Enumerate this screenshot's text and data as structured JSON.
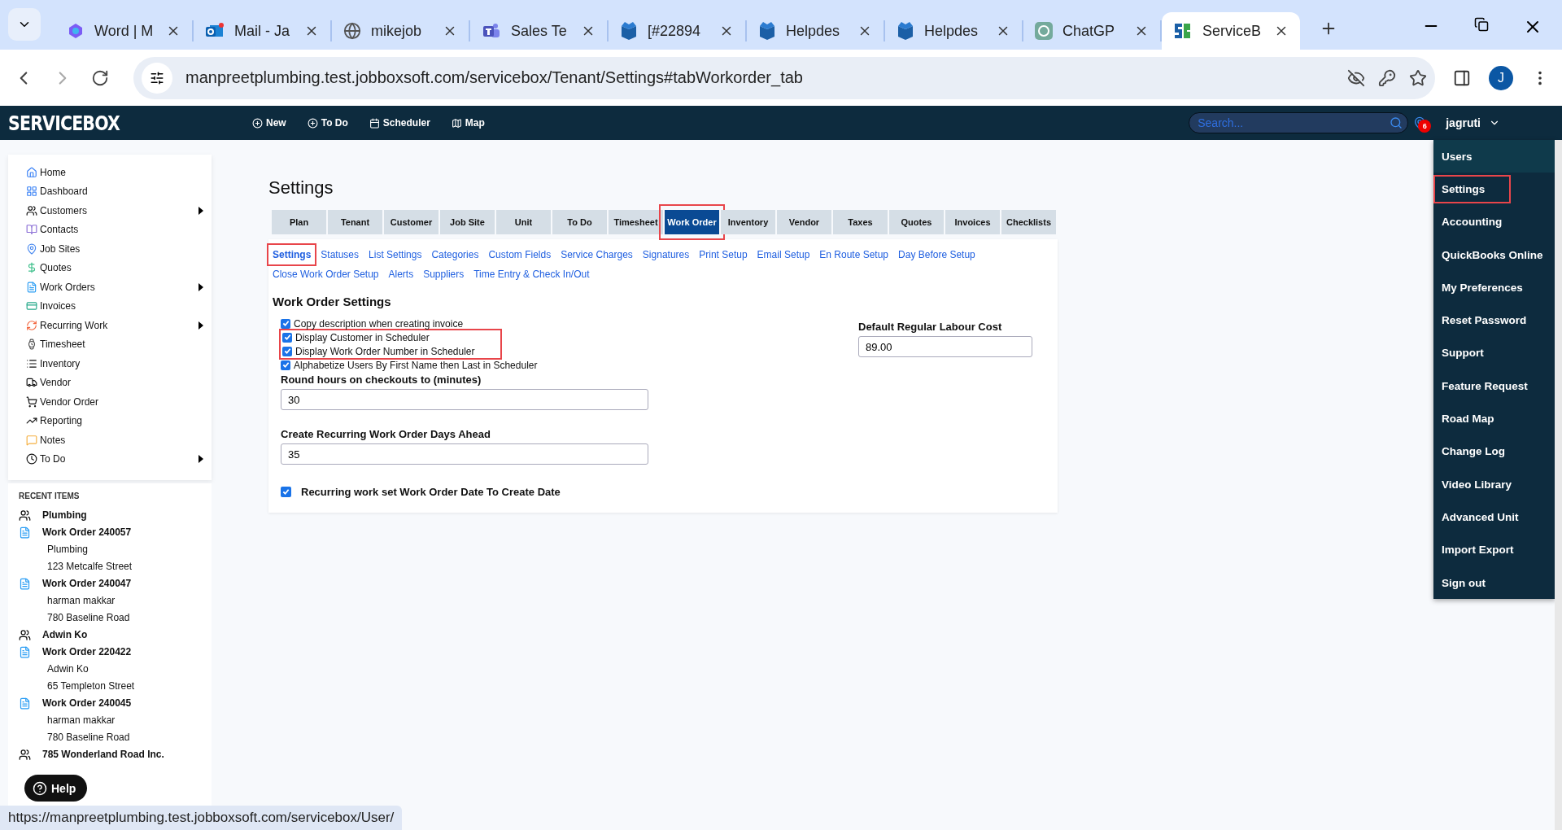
{
  "browser": {
    "tabs": [
      {
        "title": "Word | M",
        "selected": false
      },
      {
        "title": "Mail - Ja",
        "selected": false
      },
      {
        "title": "mikejob",
        "selected": false
      },
      {
        "title": "Sales Te",
        "selected": false
      },
      {
        "title": "[#22894",
        "selected": false
      },
      {
        "title": "Helpdes",
        "selected": false
      },
      {
        "title": "Helpdes",
        "selected": false
      },
      {
        "title": "ChatGP",
        "selected": false
      },
      {
        "title": "ServiceB",
        "selected": true
      }
    ],
    "address": "manpreetplumbing.test.jobboxsoft.com/servicebox/Tenant/Settings#tabWorkorder_tab",
    "profile_initial": "J"
  },
  "app": {
    "logo": "SERVICEBOX",
    "nav": [
      "New",
      "To Do",
      "Scheduler",
      "Map"
    ],
    "search": {
      "placeholder": "Search..."
    },
    "notification_count": "6",
    "user": "jagruti"
  },
  "sidebar": {
    "items": [
      {
        "label": "Home",
        "has_submenu": false
      },
      {
        "label": "Dashboard",
        "has_submenu": false
      },
      {
        "label": "Customers",
        "has_submenu": true
      },
      {
        "label": "Contacts",
        "has_submenu": false
      },
      {
        "label": "Job Sites",
        "has_submenu": false
      },
      {
        "label": "Quotes",
        "has_submenu": false
      },
      {
        "label": "Work Orders",
        "has_submenu": true
      },
      {
        "label": "Invoices",
        "has_submenu": false
      },
      {
        "label": "Recurring Work",
        "has_submenu": true
      },
      {
        "label": "Timesheet",
        "has_submenu": false
      },
      {
        "label": "Inventory",
        "has_submenu": false
      },
      {
        "label": "Vendor",
        "has_submenu": false
      },
      {
        "label": "Vendor Order",
        "has_submenu": false
      },
      {
        "label": "Reporting",
        "has_submenu": false
      },
      {
        "label": "Notes",
        "has_submenu": false
      },
      {
        "label": "To Do",
        "has_submenu": true
      }
    ]
  },
  "recent_items": {
    "title": "RECENT ITEMS",
    "items": [
      {
        "kind": "customer",
        "title": "Plumbing"
      },
      {
        "kind": "work_order",
        "title": "Work Order 240057",
        "lines": [
          "Plumbing",
          "123 Metcalfe Street"
        ]
      },
      {
        "kind": "work_order",
        "title": "Work Order 240047",
        "lines": [
          "harman makkar",
          "780 Baseline Road"
        ]
      },
      {
        "kind": "customer",
        "title": "Adwin Ko"
      },
      {
        "kind": "work_order",
        "title": "Work Order 220422",
        "lines": [
          "Adwin Ko",
          "65 Templeton Street"
        ]
      },
      {
        "kind": "work_order",
        "title": "Work Order 240045",
        "lines": [
          "harman makkar",
          "780 Baseline Road"
        ]
      },
      {
        "kind": "customer",
        "title": "785 Wonderland Road Inc."
      }
    ]
  },
  "page": {
    "title": "Settings",
    "tabs": [
      {
        "label": "Plan",
        "selected": false,
        "highlighted": false
      },
      {
        "label": "Tenant",
        "selected": false,
        "highlighted": false
      },
      {
        "label": "Customer",
        "selected": false,
        "highlighted": false
      },
      {
        "label": "Job Site",
        "selected": false,
        "highlighted": false
      },
      {
        "label": "Unit",
        "selected": false,
        "highlighted": false
      },
      {
        "label": "To Do",
        "selected": false,
        "highlighted": false
      },
      {
        "label": "Timesheet",
        "selected": false,
        "highlighted": false
      },
      {
        "label": "Work Order",
        "selected": true,
        "highlighted": true
      },
      {
        "label": "Inventory",
        "selected": false,
        "highlighted": false
      },
      {
        "label": "Vendor",
        "selected": false,
        "highlighted": false
      },
      {
        "label": "Taxes",
        "selected": false,
        "highlighted": false
      },
      {
        "label": "Quotes",
        "selected": false,
        "highlighted": false
      },
      {
        "label": "Invoices",
        "selected": false,
        "highlighted": false
      },
      {
        "label": "Checklists",
        "selected": false,
        "highlighted": false
      }
    ],
    "subtabs": [
      {
        "label": "Settings",
        "selected": true,
        "highlighted": true
      },
      {
        "label": "Statuses",
        "selected": false,
        "highlighted": false
      },
      {
        "label": "List Settings",
        "selected": false,
        "highlighted": false
      },
      {
        "label": "Categories",
        "selected": false,
        "highlighted": false
      },
      {
        "label": "Custom Fields",
        "selected": false,
        "highlighted": false
      },
      {
        "label": "Service Charges",
        "selected": false,
        "highlighted": false
      },
      {
        "label": "Signatures",
        "selected": false,
        "highlighted": false
      },
      {
        "label": "Print Setup",
        "selected": false,
        "highlighted": false
      },
      {
        "label": "Email Setup",
        "selected": false,
        "highlighted": false
      },
      {
        "label": "En Route Setup",
        "selected": false,
        "highlighted": false
      },
      {
        "label": "Day Before Setup",
        "selected": false,
        "highlighted": false
      },
      {
        "label": "Close Work Order Setup",
        "selected": false,
        "highlighted": false
      },
      {
        "label": "Alerts",
        "selected": false,
        "highlighted": false
      },
      {
        "label": "Suppliers",
        "selected": false,
        "highlighted": false
      },
      {
        "label": "Time Entry & Check In/Out",
        "selected": false,
        "highlighted": false
      }
    ],
    "section_title": "Work Order Settings",
    "options": [
      {
        "label": "Copy description when creating invoice",
        "checked": true,
        "highlighted": false
      },
      {
        "label": "Display Customer in Scheduler",
        "checked": true,
        "highlighted": true
      },
      {
        "label": "Display Work Order Number in Scheduler",
        "checked": true,
        "highlighted": true
      },
      {
        "label": "Alphabetize Users By First Name then Last in Scheduler",
        "checked": true,
        "highlighted": false
      }
    ],
    "fields": [
      {
        "label": "Round hours on checkouts to (minutes)",
        "value": "30"
      },
      {
        "label": "Create Recurring Work Order Days Ahead",
        "value": "35"
      }
    ],
    "final_option": {
      "label": "Recurring work set Work Order Date To Create Date",
      "checked": true
    },
    "labour_cost": {
      "label": "Default Regular Labour Cost",
      "value": "89.00"
    }
  },
  "user_menu": {
    "items": [
      {
        "label": "Users",
        "hovered": true,
        "highlighted": false
      },
      {
        "label": "Settings",
        "hovered": false,
        "highlighted": true
      },
      {
        "label": "Accounting",
        "hovered": false,
        "highlighted": false
      },
      {
        "label": "QuickBooks Online",
        "hovered": false,
        "highlighted": false
      },
      {
        "label": "My Preferences",
        "hovered": false,
        "highlighted": false
      },
      {
        "label": "Reset Password",
        "hovered": false,
        "highlighted": false
      },
      {
        "label": "Support",
        "hovered": false,
        "highlighted": false
      },
      {
        "label": "Feature Request",
        "hovered": false,
        "highlighted": false
      },
      {
        "label": "Road Map",
        "hovered": false,
        "highlighted": false
      },
      {
        "label": "Change Log",
        "hovered": false,
        "highlighted": false
      },
      {
        "label": "Video Library",
        "hovered": false,
        "highlighted": false
      },
      {
        "label": "Advanced Unit",
        "hovered": false,
        "highlighted": false
      },
      {
        "label": "Import Export",
        "hovered": false,
        "highlighted": false
      },
      {
        "label": "Sign out",
        "hovered": false,
        "highlighted": false
      }
    ]
  },
  "help": "Help",
  "status_url": "https://manpreetplumbing.test.jobboxsoft.com/servicebox/User/"
}
